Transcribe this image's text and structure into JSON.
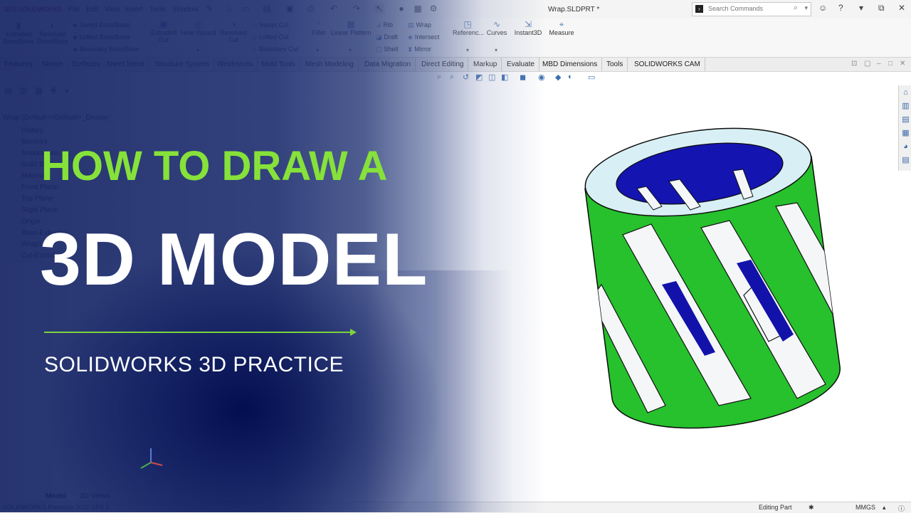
{
  "app": {
    "logo_text": "3DS SOLIDWORKS",
    "menus": [
      "File",
      "Edit",
      "View",
      "Insert",
      "Tools",
      "Window"
    ],
    "document_title": "Wrap.SLDPRT *",
    "search": {
      "placeholder": "Search Commands"
    }
  },
  "ribbon": {
    "large": [
      {
        "label": "Extruded\nBoss/Base"
      },
      {
        "label": "Revolved\nBoss/Base"
      },
      {
        "label": "Extruded\nCut"
      },
      {
        "label": "Hole Wizard"
      },
      {
        "label": "Revolved\nCut"
      },
      {
        "label": "Fillet"
      },
      {
        "label": "Linear Pattern"
      },
      {
        "label": "Referenc..."
      },
      {
        "label": "Curves"
      },
      {
        "label": "Instant3D"
      },
      {
        "label": "Measure"
      }
    ],
    "small": [
      {
        "label": "Swept Boss/Base"
      },
      {
        "label": "Lofted Boss/Base"
      },
      {
        "label": "Boundary Boss/Base"
      },
      {
        "label": "Swept Cut"
      },
      {
        "label": "Lofted Cut"
      },
      {
        "label": "Boundary Cut"
      },
      {
        "label": "Rib"
      },
      {
        "label": "Draft"
      },
      {
        "label": "Shell"
      },
      {
        "label": "Wrap"
      },
      {
        "label": "Intersect"
      },
      {
        "label": "Mirror"
      }
    ]
  },
  "tabs": [
    "Features",
    "Sketch",
    "Surfaces",
    "Sheet Metal",
    "Structure System",
    "Weldments",
    "Mold Tools",
    "Mesh Modeling",
    "Data Migration",
    "Direct Editing",
    "Markup",
    "Evaluate",
    "MBD Dimensions",
    "Tools",
    "SOLIDWORKS CAM"
  ],
  "feature_tree": {
    "root": "Wrap (Default<<Default>_Display",
    "items": [
      "History",
      "Sensors",
      "Annotations",
      "Solid Bodies",
      "Material",
      "Front Plane",
      "Top Plane",
      "Right Plane",
      "Origin",
      "Boss-Extrude1",
      "Wrap1",
      "Cut-Extrude1"
    ]
  },
  "bottom_tabs": [
    "Model",
    "3D Views"
  ],
  "status": {
    "left": "SOLIDWORKS Premium 2021 SP0.1",
    "editing": "Editing Part",
    "units": "MMGS"
  },
  "headline": {
    "line1": "HOW TO DRAW A",
    "line2": "3D MODEL",
    "subtitle": "SOLIDWORKS 3D PRACTICE"
  },
  "colors": {
    "accent_green": "#86e23a",
    "overlay_blue": "#14236b",
    "model_green": "#22c22a",
    "model_blue": "#1010a8"
  }
}
